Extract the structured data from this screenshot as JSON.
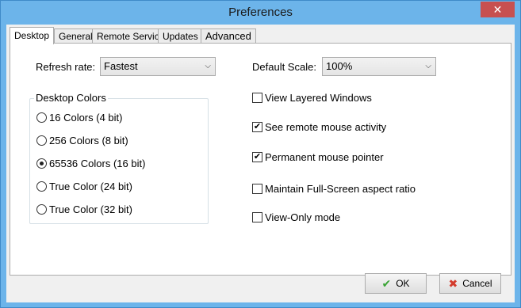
{
  "window": {
    "title": "Preferences",
    "close_glyph": "✕"
  },
  "tabs": [
    {
      "label": "Desktop"
    },
    {
      "label": "General"
    },
    {
      "label": "Remote Service"
    },
    {
      "label": "Updates"
    },
    {
      "label": "Advanced"
    }
  ],
  "refresh": {
    "label": "Refresh rate:",
    "value": "Fastest"
  },
  "scale": {
    "label": "Default Scale:",
    "value": "100%"
  },
  "desktop_colors": {
    "title": "Desktop Colors",
    "options": [
      {
        "label": "16 Colors (4 bit)",
        "selected": false
      },
      {
        "label": "256 Colors (8 bit)",
        "selected": false
      },
      {
        "label": "65536 Colors (16 bit)",
        "selected": true
      },
      {
        "label": "True Color (24 bit)",
        "selected": false
      },
      {
        "label": "True Color (32 bit)",
        "selected": false
      }
    ]
  },
  "checkboxes": [
    {
      "label": "View Layered Windows",
      "checked": false
    },
    {
      "label": "See remote mouse activity",
      "checked": true
    },
    {
      "label": "Permanent mouse pointer",
      "checked": true
    },
    {
      "label": "Maintain Full-Screen aspect ratio",
      "checked": false
    },
    {
      "label": "View-Only mode",
      "checked": false
    }
  ],
  "buttons": {
    "ok": {
      "label": "OK",
      "icon": "✔"
    },
    "cancel": {
      "label": "Cancel",
      "icon": "✖"
    }
  },
  "icons": {
    "check_mark": "✔",
    "dropdown": "⌵"
  }
}
